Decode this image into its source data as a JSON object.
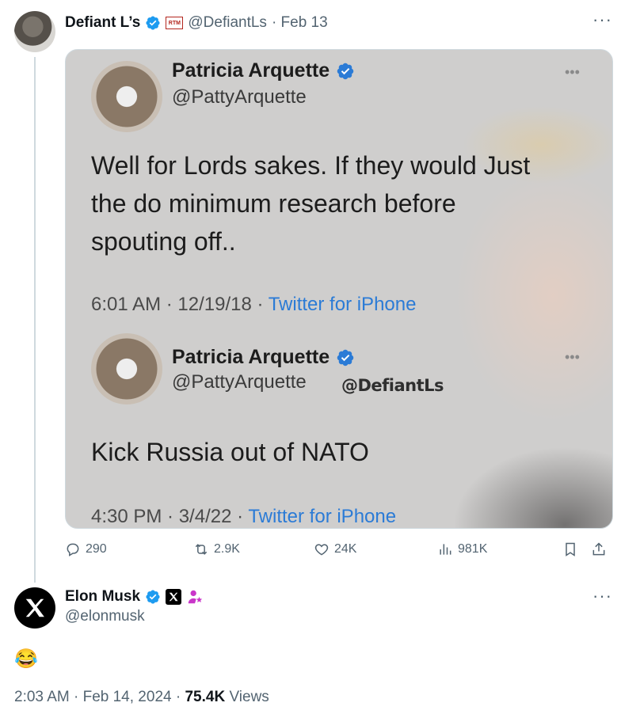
{
  "tweet": {
    "author_name": "Defiant L’s",
    "author_badge_text": "RTM",
    "author_handle": "@DefiantLs",
    "date": "· Feb 13",
    "more_icon": "more-horizontal-icon",
    "media": {
      "post1": {
        "name": "Patricia Arquette",
        "handle": "@PattyArquette",
        "text": "Well for Lords sakes. If they would Just\nthe do minimum research before\nspouting off..",
        "time": "6:01 AM · 12/19/18 · ",
        "source": "Twitter for iPhone"
      },
      "post2": {
        "name": "Patricia Arquette",
        "handle": "@PattyArquette",
        "watermark": "@DefiantLs",
        "text": "Kick Russia out of NATO",
        "time": "4:30 PM · 3/4/22 · ",
        "source": "Twitter for iPhone"
      }
    },
    "actions": {
      "replies": "290",
      "reposts": "2.9K",
      "likes": "24K",
      "views": "981K"
    }
  },
  "reply": {
    "author_name": "Elon Musk",
    "author_handle": "@elonmusk",
    "text": "😂",
    "time": "2:03 AM · Feb 14, 2024 · ",
    "views_count": "75.4K",
    "views_label": " Views"
  },
  "colors": {
    "verified": "#1d9bf0",
    "muted": "#536471",
    "link": "#2b7bd6",
    "affiliate": "#c936c9"
  }
}
